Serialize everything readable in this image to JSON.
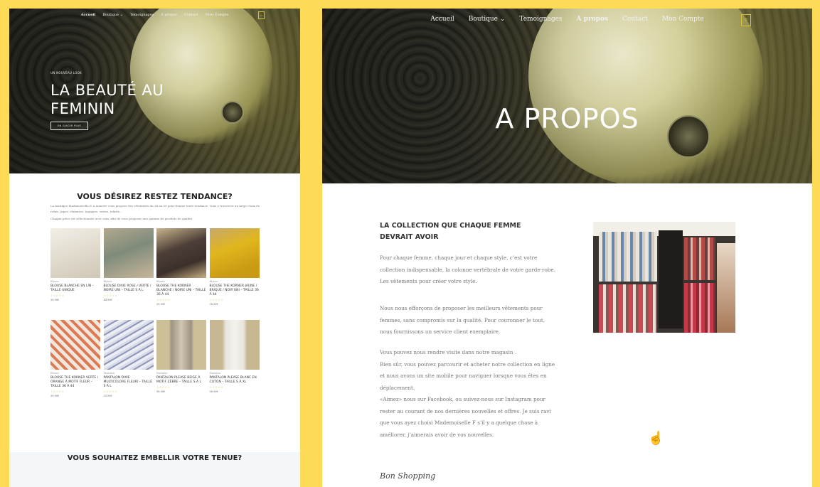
{
  "colors": {
    "background": "#fedb57",
    "accent": "#d9c23a",
    "heading": "#222222",
    "body_text": "#777777"
  },
  "left": {
    "nav": {
      "items": [
        "Accueil",
        "Boutique",
        "Temoignages",
        "A propos",
        "Contact",
        "Mon Compte"
      ],
      "active": "Accueil"
    },
    "cart_count": "0",
    "hero": {
      "kicker": "UN NOUVEAU LOOK",
      "title": "LA BEAUTÉ AU FEMININ",
      "button": "EN SAVOIR PLUS"
    },
    "section_title": "VOUS DÉSIREZ RESTEZ TENDANCE?",
    "intro": [
      "La boutique Mademoiselle F. à Auxerre vous propose des vêtements du 34 au 50 pour femme toute tendance. Vous y trouverez un large choix de robes, jupes, chemises, tuniques, vestes, tshirts...",
      "Chaque pièce est sélectionnée avec soin, afin de vous proposer une gamme de produits de qualité."
    ],
    "products": [
      {
        "category": "Blouse",
        "name": "BLOUSE BLANCHE EN LIN – TAILLE UNIQUE",
        "price": "39,90€",
        "color": "#e9e4d8"
      },
      {
        "category": "Blouse",
        "name": "BLOUSE DIXIE ROSE / VERTE / NOIRE UNI – TAILLE S À L",
        "price": "44,90€",
        "color": "#8d9a8a"
      },
      {
        "category": "Blouse",
        "name": "BLOUSE THE KORNER BLANCHE / NOIRE UNI – TAILLE 36 À 44",
        "price": "39,90€",
        "color": "#5a4a40"
      },
      {
        "category": "Blouse",
        "name": "BLOUSE THE KORNER JAUNE / BRIQUE / NOIR UNI – TAILLE 36 À 44",
        "price": "38,90€",
        "color": "#d9b32a"
      },
      {
        "category": "Blouse",
        "name": "BLOUSE THE KORNER VERTE / ORANGE À MOTIF FLEUR – TAILLE 36 À 44",
        "price": "39,90€",
        "color": "#e39a7c"
      },
      {
        "category": "Pantalon",
        "name": "PANTALON DIXIE MULTICOLORE FLEURI – TAILLE S À L",
        "price": "55,90€",
        "color": "#c9cbd9"
      },
      {
        "category": "Pantalon",
        "name": "PANTALON PLEASE BEIGE À MOTIF ZÈBRE – TAILLE S À L",
        "price": "98,90€",
        "color": "#b9ab95"
      },
      {
        "category": "Pantalon",
        "name": "PANTALON PLEASE BLANC EN COTON – TAILLE S À XL",
        "price": "98,90€",
        "color": "#d7d3c9"
      }
    ],
    "bottom_title": "VOUS SOUHAITEZ EMBELLIR VOTRE TENUE?"
  },
  "right": {
    "nav": {
      "items": [
        "Accueil",
        "Boutique",
        "Temoignages",
        "A propos",
        "Contact",
        "Mon Compte"
      ],
      "active": "A propos"
    },
    "cart_count": "0",
    "hero_title": "A PROPOS",
    "heading": "LA COLLECTION QUE CHAQUE FEMME DEVRAIT AVOIR",
    "paragraphs": [
      "Pour chaque femme, chaque jour et chaque style, c’est votre collection indispensable, la colonne vertébrale de votre garde-robe. Les vêtements pour créer votre style.",
      "Nous nous efforçons de proposer les meilleurs vêtements pour femmes, sans compromis sur la qualité. Pour couronner le tout, nous fournissons un service client exemplaire.",
      "Vous pouvez nous rendre visite dans notre magasin .\nBien sûr, vous pouvez parcourir et acheter notre collection en ligne et nous avons un site mobile pour naviguer lorsque vous êtes en déplacement.\n«Aimez» nous sur Facebook, ou suivez-nous sur Instagram pour rester au courant de nos dernières nouvelles et offres. Je suis ravi que vous ayez choisi Mademoiselle F s’il y a quelque chose à améliorer, j’aimerais avoir de vos nouvelles."
    ],
    "signature": "Bon Shopping"
  }
}
